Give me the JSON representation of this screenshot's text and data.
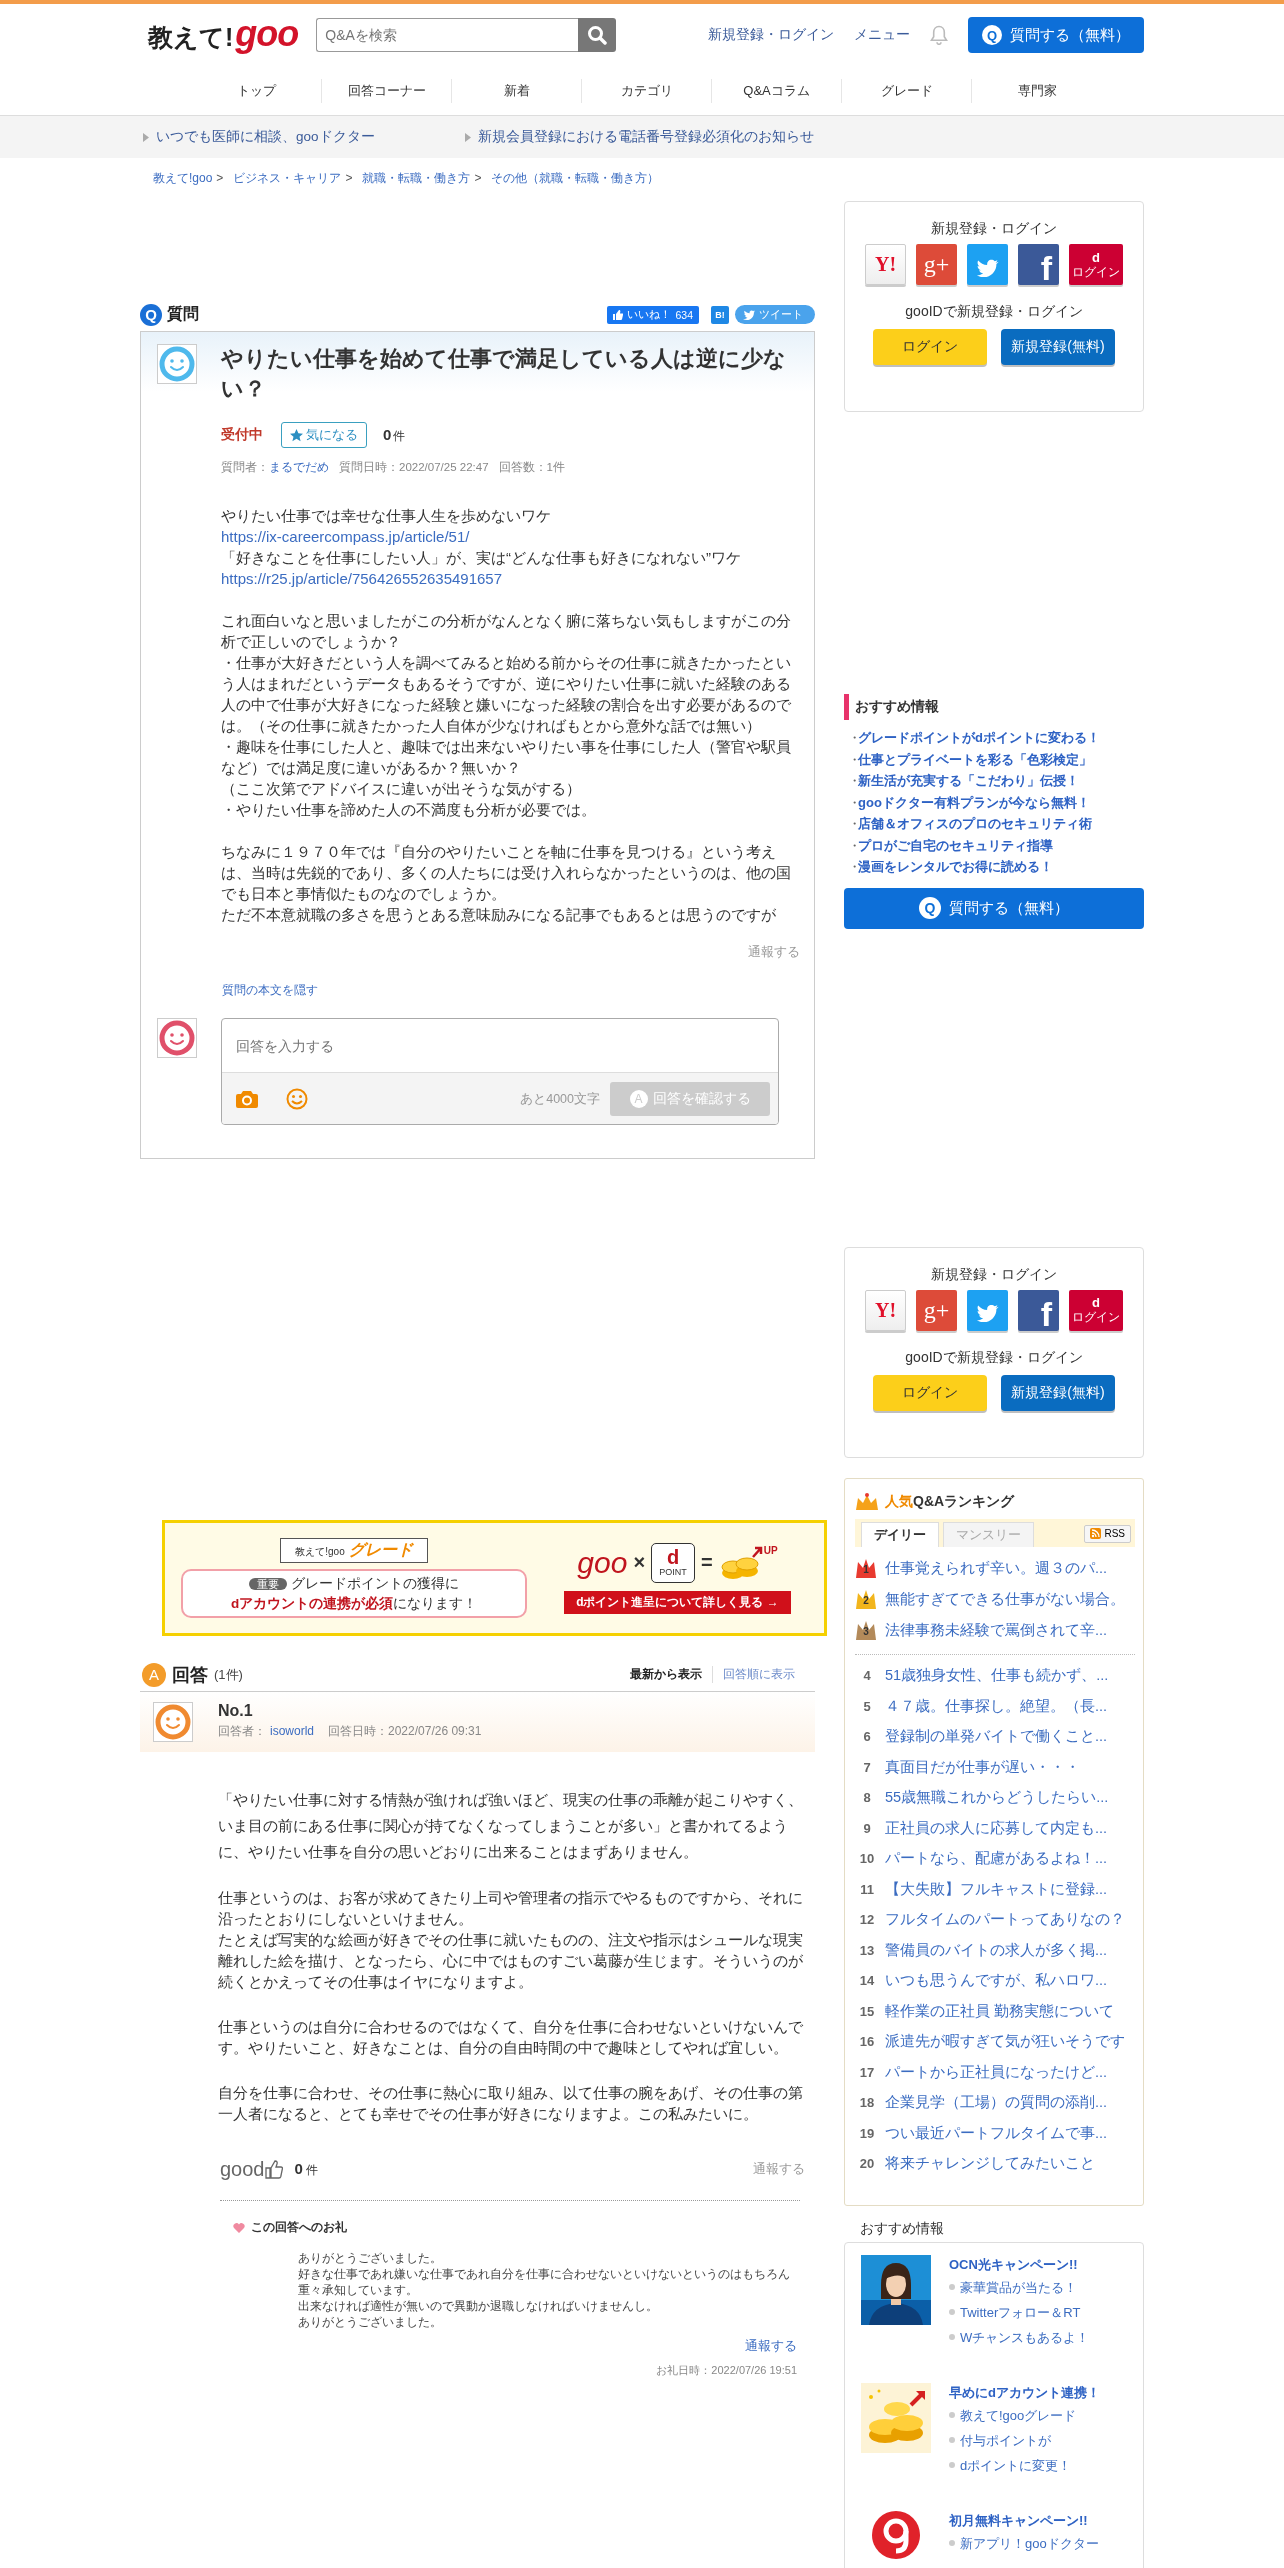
{
  "header": {
    "logo_text": "教えて!",
    "logo_brand": "goo",
    "search": {
      "placeholder": "Q&Aを検索"
    },
    "links": [
      "新規登録・ログイン",
      "メニュー"
    ],
    "ask_button": {
      "badge": "Q",
      "label": "質問する（無料）"
    }
  },
  "nav": [
    "トップ",
    "回答コーナー",
    "新着",
    "カテゴリ",
    "Q&Aコラム",
    "グレード",
    "専門家"
  ],
  "notices": [
    "いつでも医師に相談、gooドクター",
    "新規会員登録における電話番号登録必須化のお知らせ"
  ],
  "breadcrumb": [
    {
      "label": "教えて!goo",
      "sep": ">"
    },
    {
      "label": "ビジネス・キャリア",
      "sep": ">"
    },
    {
      "label": "就職・転職・働き方",
      "sep": ">"
    },
    {
      "label": "その他（就職・転職・働き方）"
    }
  ],
  "question": {
    "badge": "Q",
    "section_title": "質問",
    "like": {
      "label": "いいね！",
      "count": "634"
    },
    "bookmark": "B!",
    "tweet": "ツイート",
    "title": "やりたい仕事を始めて仕事で満足している人は逆に少ない？",
    "status": "受付中",
    "follow_button": "気になる",
    "follow_count": "0",
    "follow_unit": "件",
    "asker_label": "質問者：",
    "asker": "まるでだめ",
    "date": "質問日時：2022/07/25 22:47",
    "answer_count": "回答数：1件",
    "body": [
      [
        [
          {
            "kind": "text",
            "text": "やりたい仕事では幸せな仕事人生を歩めないワケ　"
          },
          {
            "kind": "link",
            "text": "https://ix-careercompass.jp/article/51/"
          }
        ],
        [
          {
            "kind": "text",
            "text": "「好きなことを仕事にしたい人」が、実は“どんな仕事も好きになれない”ワケ　"
          },
          {
            "kind": "link",
            "text": "https://r25.jp/article/756426552635491657"
          }
        ]
      ],
      [
        [
          {
            "kind": "text",
            "text": "これ面白いなと思いましたがこの分析がなんとなく腑に落ちない気もしますがこの分析で正しいのでしょうか？"
          }
        ],
        [
          {
            "kind": "text",
            "text": "・仕事が大好きだという人を調べてみると始める前からその仕事に就きたかったという人はまれだというデータもあるそうですが、逆にやりたい仕事に就いた経験のある人の中で仕事が大好きになった経験と嫌いになった経験の割合を出す必要があるのでは。（その仕事に就きたかった人自体が少なければもとから意外な話では無い）"
          }
        ],
        [
          {
            "kind": "text",
            "text": "・趣味を仕事にした人と、趣味では出来ないやりたい事を仕事にした人（警官や駅員など）では満足度に違いがあるか？無いか？"
          }
        ],
        [
          {
            "kind": "text",
            "text": "（ここ次第でアドバイスに違いが出そうな気がする）"
          }
        ],
        [
          {
            "kind": "text",
            "text": "・やりたい仕事を諦めた人の不満度も分析が必要では。"
          }
        ]
      ],
      [
        [
          {
            "kind": "text",
            "text": "ちなみに１９７０年では『自分のやりたいことを軸に仕事を見つける』という考えは、当時は先鋭的であり、多くの人たちには受け入れらなかったというのは、他の国でも日本と事情似たものなのでしょうか。"
          }
        ],
        [
          {
            "kind": "text",
            "text": "ただ不本意就職の多さを思うとある意味励みになる記事でもあるとは思うのですが"
          }
        ]
      ]
    ],
    "report": "通報する",
    "hide_link": "質問の本文を隠す",
    "composer": {
      "placeholder": "回答を入力する",
      "remaining": "あと4000文字",
      "submit": {
        "badge": "A",
        "label": "回答を確認する",
        "disabled": true
      }
    }
  },
  "banner": {
    "ribbon_prefix": "教えて!goo",
    "ribbon_title": "グレード",
    "tag": "重要",
    "line1": "グレードポイントの獲得に",
    "line2": "**dアカウントの連携が必須**になります！",
    "brand": "goo",
    "times": "×",
    "dpoint_letter": "d",
    "dpoint_label": "POINT",
    "equals": "=",
    "up_label": "UP",
    "link": "dポイント進呈について詳しく見る →"
  },
  "answers": {
    "badge": "A",
    "title": "回答",
    "count": "(1件)",
    "sort": [
      {
        "label": "最新から表示",
        "selected": true
      },
      {
        "label": "回答順に表示",
        "selected": false
      }
    ],
    "items": [
      {
        "number": "No.1",
        "answerer_label": "回答者：",
        "answerer": "isoworld",
        "date": "回答日時：2022/07/26 09:31",
        "body": [
          [
            "「やりたい仕事に対する情熱が強ければ強いほど、現実の仕事の乖離が起こりやすく、いま目の前にある仕事に関心が持てなくなってしまうことが多い」と書かれてるように、やりたい仕事を自分の思いどおりに出来ることはまずありません。"
          ],
          [
            "仕事というのは、お客が求めてきたり上司や管理者の指示でやるものですから、それに沿ったとおりにしないといけません。",
            "たとえば写実的な絵画が好きでその仕事に就いたものの、注文や指示はシュールな現実離れした絵を描け、となったら、心に中ではものすごい葛藤が生じます。そういうのが続くとかえってその仕事はイヤになりますよ。"
          ],
          [
            "仕事というのは自分に合わせるのではなくて、自分を仕事に合わせないといけないんです。やりたいこと、好きなことは、自分の自由時間の中で趣味としてやれば宜しい。"
          ],
          [
            "自分を仕事に合わせ、その仕事に熱心に取り組み、以て仕事の腕をあげ、その仕事の第一人者になると、とても幸せでその仕事が好きになりますよ。この私みたいに。"
          ]
        ],
        "good_label": "good",
        "good_count": "0",
        "good_unit": "件",
        "report": "通報する",
        "thanks": {
          "title": "この回答へのお礼",
          "body": [
            "ありがとうございました。",
            "好きな仕事であれ嫌いな仕事であれ自分を仕事に合わせないといけないというのはもちろん重々承知しています。",
            "出来なければ適性が無いので異動か退職しなければいけませんし。",
            "ありがとうございました。"
          ],
          "report": "通報する",
          "date": "お礼日時：2022/07/26 19:51"
        }
      }
    ]
  },
  "sidebar": {
    "login_boxes": [
      {
        "title": "新規登録・ログイン",
        "social": [
          {
            "kind": "yahoo",
            "glyph": "Y!"
          },
          {
            "kind": "google",
            "glyph": "g+"
          },
          {
            "kind": "twitter"
          },
          {
            "kind": "facebook",
            "glyph": "f"
          },
          {
            "kind": "docomo",
            "glyph": "d",
            "label": "ログイン"
          }
        ],
        "gooid_text": "gooIDで新規登録・ログイン",
        "login_button": "ログイン",
        "register_button": "新規登録(無料)"
      },
      {
        "title": "新規登録・ログイン",
        "social": [
          {
            "kind": "yahoo",
            "glyph": "Y!"
          },
          {
            "kind": "google",
            "glyph": "g+"
          },
          {
            "kind": "twitter"
          },
          {
            "kind": "facebook",
            "glyph": "f"
          },
          {
            "kind": "docomo",
            "glyph": "d",
            "label": "ログイン"
          }
        ],
        "gooid_text": "gooIDで新規登録・ログイン",
        "login_button": "ログイン",
        "register_button": "新規登録(無料)"
      }
    ],
    "recommend": {
      "title": "おすすめ情報",
      "items": [
        {
          "bullet": "・",
          "label": "グレードポイントがdポイントに変わる！"
        },
        {
          "bullet": "・",
          "label": "仕事とプライベートを彩る「色彩検定」"
        },
        {
          "bullet": "・",
          "label": "新生活が充実する「こだわり」伝授！"
        },
        {
          "bullet": "・",
          "label": "gooドクター有料プランが今なら無料！"
        },
        {
          "bullet": "・",
          "label": "店舗＆オフィスのプロのセキュリティ術"
        },
        {
          "bullet": "・",
          "label": "プロがご自宅のセキュリティ指導"
        },
        {
          "bullet": "・",
          "label": "漫画をレンタルでお得に読める！"
        }
      ]
    },
    "ask_button": {
      "badge": "Q",
      "label": "質問する（無料）"
    },
    "ranking": {
      "title_accent": "人気",
      "title": "Q&Aランキング",
      "tabs": [
        {
          "label": "デイリー",
          "selected": true
        },
        {
          "label": "マンスリー",
          "selected": false
        }
      ],
      "rss": "RSS",
      "items": [
        {
          "kind": "crown",
          "rank": "1",
          "color": "#e83a2f",
          "title": "仕事覚えられず辛い。週３のパ..."
        },
        {
          "kind": "crown",
          "rank": "2",
          "color": "#f2b51c",
          "title": "無能すぎてできる仕事がない場合。"
        },
        {
          "kind": "crown",
          "rank": "3",
          "color": "#b38a5a",
          "title": "法律事務未経験で罵倒されて辛..."
        },
        {
          "kind": "plain",
          "rank": "4",
          "title": "51歳独身女性、仕事も続かず、..."
        },
        {
          "kind": "plain",
          "rank": "5",
          "title": "４７歳。仕事探し。絶望。（長..."
        },
        {
          "kind": "plain",
          "rank": "6",
          "title": "登録制の単発バイトで働くこと..."
        },
        {
          "kind": "plain",
          "rank": "7",
          "title": "真面目だが仕事が遅い・・・"
        },
        {
          "kind": "plain",
          "rank": "8",
          "title": "55歳無職これからどうしたらい..."
        },
        {
          "kind": "plain",
          "rank": "9",
          "title": "正社員の求人に応募して内定も..."
        },
        {
          "kind": "plain",
          "rank": "10",
          "title": "パートなら、配慮があるよね！..."
        },
        {
          "kind": "plain",
          "rank": "11",
          "title": "【大失敗】フルキャストに登録..."
        },
        {
          "kind": "plain",
          "rank": "12",
          "title": "フルタイムのパートってありなの？"
        },
        {
          "kind": "plain",
          "rank": "13",
          "title": "警備員のバイトの求人が多く掲..."
        },
        {
          "kind": "plain",
          "rank": "14",
          "title": "いつも思うんですが、私ハロワ..."
        },
        {
          "kind": "plain",
          "rank": "15",
          "title": "軽作業の正社員 勤務実態について"
        },
        {
          "kind": "plain",
          "rank": "16",
          "title": "派遣先が暇すぎて気が狂いそうです"
        },
        {
          "kind": "plain",
          "rank": "17",
          "title": "パートから正社員になったけど..."
        },
        {
          "kind": "plain",
          "rank": "18",
          "title": "企業見学（工場）の質問の添削..."
        },
        {
          "kind": "plain",
          "rank": "19",
          "title": "つい最近パートフルタイムで事..."
        },
        {
          "kind": "plain",
          "rank": "20",
          "title": "将来チャレンジしてみたいこと"
        }
      ]
    },
    "promo": {
      "title": "おすすめ情報",
      "cards": [
        {
          "title": "OCN光キャンペーン!!",
          "lines": [
            "豪華賞品が当たる！",
            "Twitterフォロー＆RT",
            "Wチャンスもあるよ！"
          ]
        },
        {
          "kind": "coins",
          "title": "早めにdアカウント連携！",
          "lines": [
            "教えて!gooグレード",
            "付与ポイントが",
            "dポイントに変更！"
          ]
        },
        {
          "kind": "logo",
          "title": "初月無料キャンペーン!!",
          "lines": [
            "新アプリ！gooドクター"
          ]
        }
      ]
    }
  }
}
